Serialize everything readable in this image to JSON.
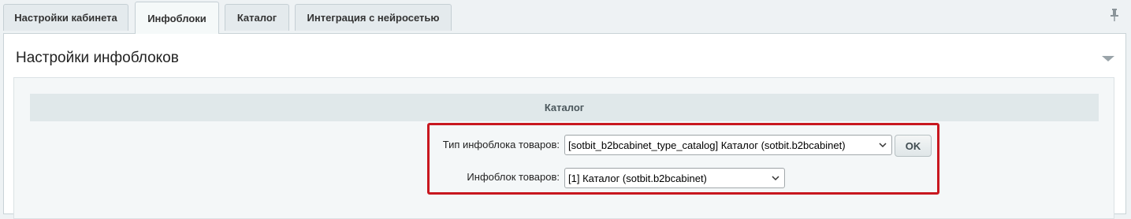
{
  "tabs": [
    {
      "label": "Настройки кабинета",
      "active": false
    },
    {
      "label": "Инфоблоки",
      "active": true
    },
    {
      "label": "Каталог",
      "active": false
    },
    {
      "label": "Интеграция с нейросетью",
      "active": false
    }
  ],
  "panel": {
    "title": "Настройки инфоблоков",
    "section_title": "Каталог"
  },
  "form": {
    "iblock_type_label": "Тип инфоблока товаров:",
    "iblock_type_value": "[sotbit_b2bcabinet_type_catalog] Каталог (sotbit.b2bcabinet)",
    "iblock_label": "Инфоблок товаров:",
    "iblock_value": "[1] Каталог (sotbit.b2bcabinet)",
    "ok_label": "OK"
  },
  "colors": {
    "highlight": "#c8171f",
    "background": "#eef2f4",
    "section_header": "#e0e8ea"
  },
  "icons": {
    "pin": "pin-icon",
    "collapse": "collapse-arrow-icon",
    "dropdown": "chevron-down-icon"
  }
}
